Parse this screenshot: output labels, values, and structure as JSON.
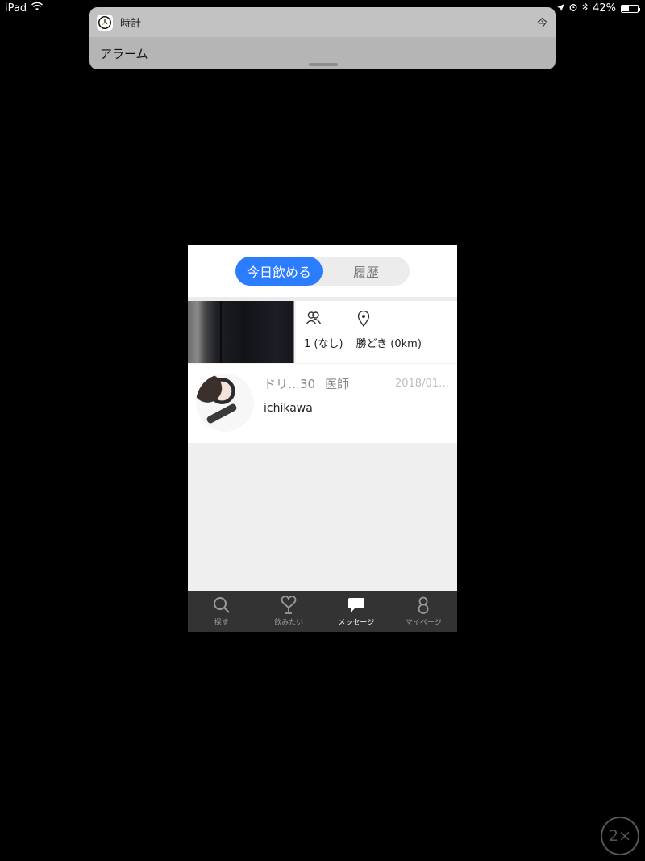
{
  "status_bar": {
    "device": "iPad",
    "battery": "42%",
    "battery_level": 0.42
  },
  "notification": {
    "app_name": "時計",
    "time": "今",
    "message": "アラーム"
  },
  "segment": {
    "options": [
      "今日飲める",
      "履歴"
    ],
    "selected": 0
  },
  "post": {
    "people": "1 (なし)",
    "location": "勝どき (0km)"
  },
  "message": {
    "name": "ドリ…30",
    "job": "医師",
    "date": "2018/01…",
    "preview": "ichikawa"
  },
  "tabs": [
    {
      "label": "探す",
      "icon": "search-icon",
      "active": false
    },
    {
      "label": "飲みたい",
      "icon": "heart-glass-icon",
      "active": false
    },
    {
      "label": "メッセージ",
      "icon": "chat-bubble-icon",
      "active": true
    },
    {
      "label": "マイページ",
      "icon": "person-icon",
      "active": false
    }
  ],
  "zoom": "2×",
  "colors": {
    "accent": "#2b7cff",
    "tab_bar": "#333333",
    "background": "#000000"
  }
}
